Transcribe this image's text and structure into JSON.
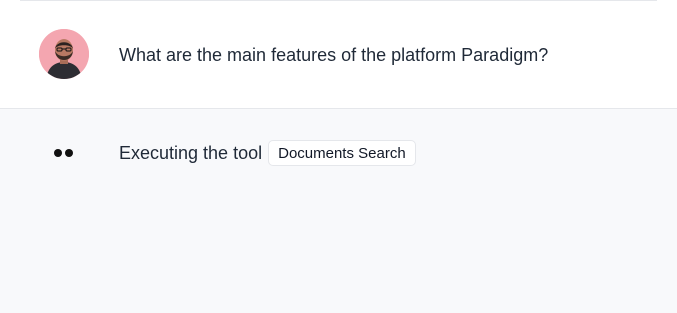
{
  "conversation": {
    "user_message": {
      "avatar_icon": "user-avatar",
      "text": "What are the main features of the platform Paradigm?"
    },
    "assistant_message": {
      "loading_icon": "typing-dots-icon",
      "status_text": "Executing the tool",
      "tool_name": "Documents Search"
    }
  },
  "colors": {
    "background": "#ffffff",
    "assistant_background": "#f8f9fb",
    "divider": "#e5e7eb",
    "text": "#1f2937",
    "avatar_background": "#f4a6b0"
  }
}
